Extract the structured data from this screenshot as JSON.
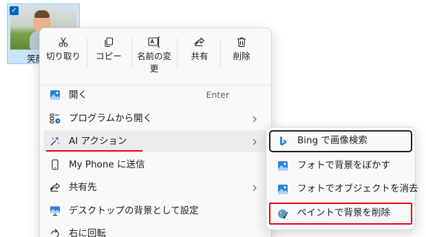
{
  "file": {
    "name": "笑顔",
    "checked": true
  },
  "toolbar": {
    "cut": "切り取り",
    "copy": "コピー",
    "rename": "名前の変更",
    "share": "共有",
    "delete": "削除"
  },
  "menu": {
    "items": [
      {
        "label": "開く",
        "shortcut": "Enter",
        "icon": "image-icon"
      },
      {
        "label": "プログラムから開く",
        "icon": "apps-icon",
        "has_submenu": true
      },
      {
        "label": "AI アクション",
        "icon": "sparkle-icon",
        "has_submenu": true
      },
      {
        "label": "My Phone に送信",
        "icon": "phone-icon"
      },
      {
        "label": "共有先",
        "icon": "share-icon",
        "has_submenu": true
      },
      {
        "label": "デスクトップの背景として設定",
        "icon": "wallpaper-icon"
      },
      {
        "label": "右に回転",
        "icon": "rotate-icon"
      }
    ]
  },
  "submenu": {
    "items": [
      {
        "label": "Bing で画像検索",
        "icon": "bing-icon"
      },
      {
        "label": "フォトで背景をぼかす",
        "icon": "photos-icon"
      },
      {
        "label": "フォトでオブジェクトを消去",
        "icon": "photos-icon"
      },
      {
        "label": "ペイントで背景を削除",
        "icon": "paint-icon"
      }
    ]
  },
  "colors": {
    "accent": "#0067c0",
    "annotation_red": "#e60012",
    "menu_bg": "#f9f9f9"
  }
}
